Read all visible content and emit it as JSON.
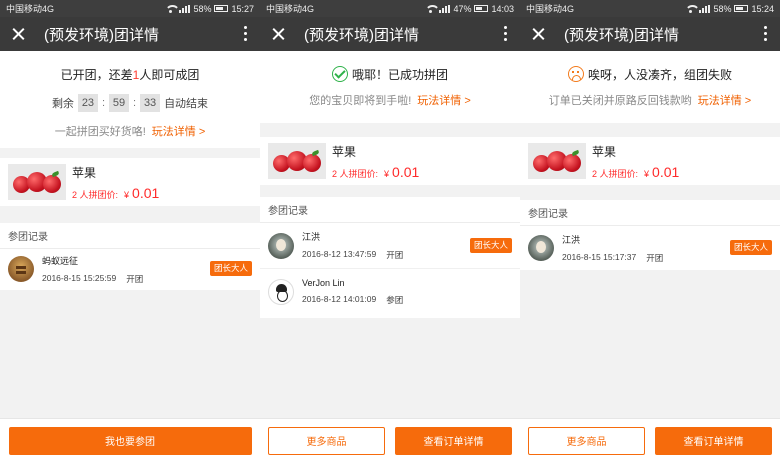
{
  "screens": [
    {
      "status_bar": {
        "carrier": "中国移动4G",
        "battery": "58%",
        "time": "15:27"
      },
      "title": "(预发环境)团详情",
      "status": {
        "title_pre": "已开团，还差",
        "need_count": "1",
        "title_post": "人即可成团",
        "countdown": {
          "prefix": "剩余",
          "hours": "23",
          "minutes": "59",
          "seconds": "33",
          "suffix": "自动结束"
        },
        "hint": "一起拼团买好货咯!",
        "link": "玩法详情 >"
      },
      "product": {
        "name": "苹果",
        "group_label": "2 人拼团价:",
        "currency": "¥",
        "price": "0.01"
      },
      "records": {
        "header": "参团记录",
        "items": [
          {
            "name": "蚂蚁远征",
            "time": "2016-8-15 15:25:59",
            "action": "开团",
            "badge": "团长大人"
          }
        ]
      },
      "buttons": {
        "primary": "我也要参团"
      }
    },
    {
      "status_bar": {
        "carrier": "中国移动4G",
        "battery": "47%",
        "time": "14:03"
      },
      "title": "(预发环境)团详情",
      "status": {
        "title": "哦耶！已成功拼团",
        "icon": "success-check-icon",
        "hint": "您的宝贝即将到手啦!",
        "link": "玩法详情 >"
      },
      "product": {
        "name": "苹果",
        "group_label": "2 人拼团价:",
        "currency": "¥",
        "price": "0.01"
      },
      "records": {
        "header": "参团记录",
        "items": [
          {
            "name": "江洪",
            "time": "2016-8-12 13:47:59",
            "action": "开团",
            "badge": "团长大人"
          },
          {
            "name": "VerJon Lin",
            "time": "2016-8-12 14:01:09",
            "action": "参团"
          }
        ]
      },
      "buttons": {
        "secondary": "更多商品",
        "primary": "查看订单详情"
      }
    },
    {
      "status_bar": {
        "carrier": "中国移动4G",
        "battery": "58%",
        "time": "15:24"
      },
      "title": "(预发环境)团详情",
      "status": {
        "title": "唉呀，人没凑齐，组团失败",
        "icon": "sad-face-icon",
        "hint": "订单已关闭并原路反回钱款哟",
        "link": "玩法详情 >"
      },
      "product": {
        "name": "苹果",
        "group_label": "2 人拼团价:",
        "currency": "¥",
        "price": "0.01"
      },
      "records": {
        "header": "参团记录",
        "items": [
          {
            "name": "江洪",
            "time": "2016-8-15 15:17:37",
            "action": "开团",
            "badge": "团长大人"
          }
        ]
      },
      "buttons": {
        "secondary": "更多商品",
        "primary": "查看订单详情"
      }
    }
  ],
  "colors": {
    "accent": "#f66b0c",
    "price": "#ff2a2a",
    "titlebar": "#3a3a3a",
    "statusbar": "#3e3e3e",
    "success": "#2fb24a"
  }
}
